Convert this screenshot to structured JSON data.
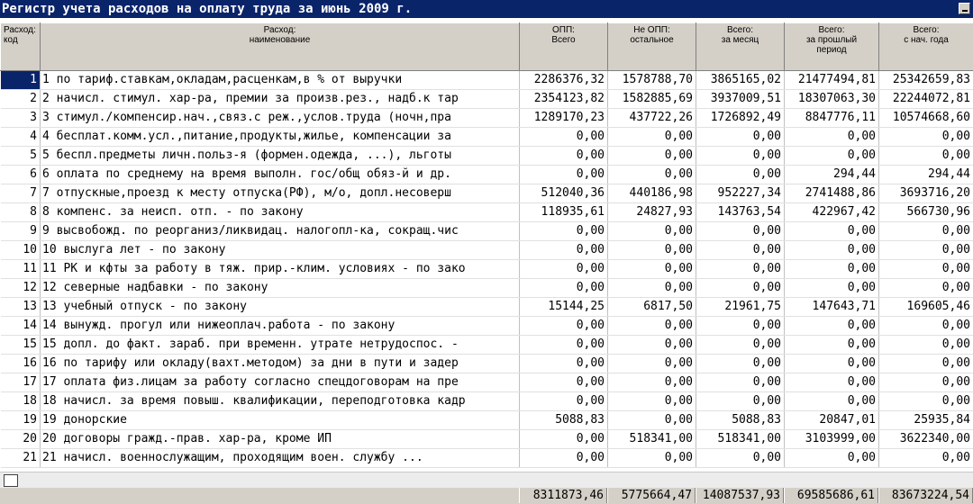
{
  "window": {
    "title": "Регистр учета расходов на оплату труда  за июнь 2009 г."
  },
  "columns": [
    {
      "l1": "Расход:",
      "l2": "код",
      "l3": ""
    },
    {
      "l1": "Расход:",
      "l2": "наименование",
      "l3": ""
    },
    {
      "l1": "ОПП:",
      "l2": "Всего",
      "l3": ""
    },
    {
      "l1": "Не ОПП:",
      "l2": "остальное",
      "l3": ""
    },
    {
      "l1": "Всего:",
      "l2": "за месяц",
      "l3": ""
    },
    {
      "l1": "Всего:",
      "l2": "за прошлый",
      "l3": "период"
    },
    {
      "l1": "Всего:",
      "l2": "с нач. года",
      "l3": ""
    }
  ],
  "rows": [
    {
      "code": "1",
      "name": "1 по тариф.ставкам,окладам,расценкам,в % от выручки",
      "opp": "2286376,32",
      "neopp": "1578788,70",
      "month": "3865165,02",
      "prev": "21477494,81",
      "ytd": "25342659,83",
      "selected": true
    },
    {
      "code": "2",
      "name": "2 начисл. стимул. хар-ра, премии за произв.рез., надб.к тар",
      "opp": "2354123,82",
      "neopp": "1582885,69",
      "month": "3937009,51",
      "prev": "18307063,30",
      "ytd": "22244072,81"
    },
    {
      "code": "3",
      "name": "3 стимул./компенсир.нач.,связ.с реж.,услов.труда (ночн,пра",
      "opp": "1289170,23",
      "neopp": "437722,26",
      "month": "1726892,49",
      "prev": "8847776,11",
      "ytd": "10574668,60"
    },
    {
      "code": "4",
      "name": "4 бесплат.комм.усл.,питание,продукты,жилье, компенсации за",
      "opp": "0,00",
      "neopp": "0,00",
      "month": "0,00",
      "prev": "0,00",
      "ytd": "0,00"
    },
    {
      "code": "5",
      "name": "5 беспл.предметы личн.польз-я (формен.одежда, ...), льготы",
      "opp": "0,00",
      "neopp": "0,00",
      "month": "0,00",
      "prev": "0,00",
      "ytd": "0,00"
    },
    {
      "code": "6",
      "name": "6 оплата по среднему на время выполн. гос/общ обяз-й и др.",
      "opp": "0,00",
      "neopp": "0,00",
      "month": "0,00",
      "prev": "294,44",
      "ytd": "294,44"
    },
    {
      "code": "7",
      "name": "7 отпускные,проезд к месту отпуска(РФ), м/о, допл.несоверш",
      "opp": "512040,36",
      "neopp": "440186,98",
      "month": "952227,34",
      "prev": "2741488,86",
      "ytd": "3693716,20"
    },
    {
      "code": "8",
      "name": "8 компенс. за неисп. отп. - по закону",
      "opp": "118935,61",
      "neopp": "24827,93",
      "month": "143763,54",
      "prev": "422967,42",
      "ytd": "566730,96"
    },
    {
      "code": "9",
      "name": "9 высвобожд. по реорганиз/ликвидац. налогопл-ка, сокращ.чис",
      "opp": "0,00",
      "neopp": "0,00",
      "month": "0,00",
      "prev": "0,00",
      "ytd": "0,00"
    },
    {
      "code": "10",
      "name": "10 выслуга лет - по закону",
      "opp": "0,00",
      "neopp": "0,00",
      "month": "0,00",
      "prev": "0,00",
      "ytd": "0,00"
    },
    {
      "code": "11",
      "name": "11 РК и кфты за работу в тяж. прир.-клим. условиях - по зако",
      "opp": "0,00",
      "neopp": "0,00",
      "month": "0,00",
      "prev": "0,00",
      "ytd": "0,00"
    },
    {
      "code": "12",
      "name": "12 северные надбавки - по закону",
      "opp": "0,00",
      "neopp": "0,00",
      "month": "0,00",
      "prev": "0,00",
      "ytd": "0,00"
    },
    {
      "code": "13",
      "name": "13 учебный отпуск - по закону",
      "opp": "15144,25",
      "neopp": "6817,50",
      "month": "21961,75",
      "prev": "147643,71",
      "ytd": "169605,46"
    },
    {
      "code": "14",
      "name": "14 вынужд. прогул или нижеоплач.работа - по закону",
      "opp": "0,00",
      "neopp": "0,00",
      "month": "0,00",
      "prev": "0,00",
      "ytd": "0,00"
    },
    {
      "code": "15",
      "name": "15 допл. до факт. зараб. при временн. утрате нетрудоспос. -",
      "opp": "0,00",
      "neopp": "0,00",
      "month": "0,00",
      "prev": "0,00",
      "ytd": "0,00"
    },
    {
      "code": "16",
      "name": "16 по тарифу или окладу(вахт.методом) за дни в пути и задер",
      "opp": "0,00",
      "neopp": "0,00",
      "month": "0,00",
      "prev": "0,00",
      "ytd": "0,00"
    },
    {
      "code": "17",
      "name": "17 оплата физ.лицам за работу согласно спецдоговорам на пре",
      "opp": "0,00",
      "neopp": "0,00",
      "month": "0,00",
      "prev": "0,00",
      "ytd": "0,00"
    },
    {
      "code": "18",
      "name": "18 начисл. за время повыш. квалификации, переподготовка кадр",
      "opp": "0,00",
      "neopp": "0,00",
      "month": "0,00",
      "prev": "0,00",
      "ytd": "0,00"
    },
    {
      "code": "19",
      "name": "19 донорские",
      "opp": "5088,83",
      "neopp": "0,00",
      "month": "5088,83",
      "prev": "20847,01",
      "ytd": "25935,84"
    },
    {
      "code": "20",
      "name": "20 договоры гражд.-прав. хар-ра, кроме ИП",
      "opp": "0,00",
      "neopp": "518341,00",
      "month": "518341,00",
      "prev": "3103999,00",
      "ytd": "3622340,00"
    },
    {
      "code": "21",
      "name": "21 начисл. военнослужащим, проходящим воен. службу ...",
      "opp": "0,00",
      "neopp": "0,00",
      "month": "0,00",
      "prev": "0,00",
      "ytd": "0,00"
    }
  ],
  "totals": {
    "opp": "8311873,46",
    "neopp": "5775664,47",
    "month": "14087537,93",
    "prev": "69585686,61",
    "ytd": "83673224,54"
  }
}
